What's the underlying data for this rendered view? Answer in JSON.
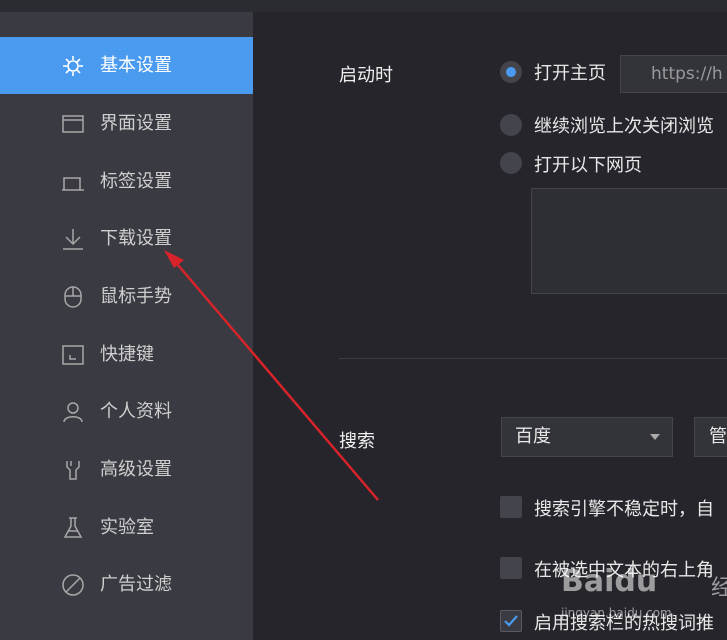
{
  "sidebar": {
    "items": [
      {
        "label": "基本设置",
        "icon": "gear-icon",
        "active": true
      },
      {
        "label": "界面设置",
        "icon": "window-icon"
      },
      {
        "label": "标签设置",
        "icon": "tab-icon"
      },
      {
        "label": "下载设置",
        "icon": "download-icon"
      },
      {
        "label": "鼠标手势",
        "icon": "mouse-icon"
      },
      {
        "label": "快捷键",
        "icon": "keyboard-icon"
      },
      {
        "label": "个人资料",
        "icon": "user-icon"
      },
      {
        "label": "高级设置",
        "icon": "wrench-icon"
      },
      {
        "label": "实验室",
        "icon": "flask-icon"
      },
      {
        "label": "广告过滤",
        "icon": "block-icon"
      }
    ]
  },
  "startup": {
    "label": "启动时",
    "options": [
      {
        "label": "打开主页",
        "checked": true
      },
      {
        "label": "继续浏览上次关闭浏览"
      },
      {
        "label": "打开以下网页"
      }
    ],
    "homepage_url": "https://h"
  },
  "search": {
    "label": "搜索",
    "engine": "百度",
    "manage_label": "管",
    "checkboxes": [
      {
        "label": "搜索引擎不稳定时，自",
        "checked": false
      },
      {
        "label": "在被选中文本的右上角",
        "checked": false
      },
      {
        "label": "启用搜索栏的热搜词推",
        "checked": true
      }
    ]
  },
  "watermark": {
    "logo": "Baidu",
    "suffix": "经验",
    "site": "jingyan.baidu.com"
  },
  "colors": {
    "accent": "#4a9bf0",
    "sidebar": "#3a3b42",
    "main": "#25252b",
    "annotation_arrow": "#d9232a"
  }
}
